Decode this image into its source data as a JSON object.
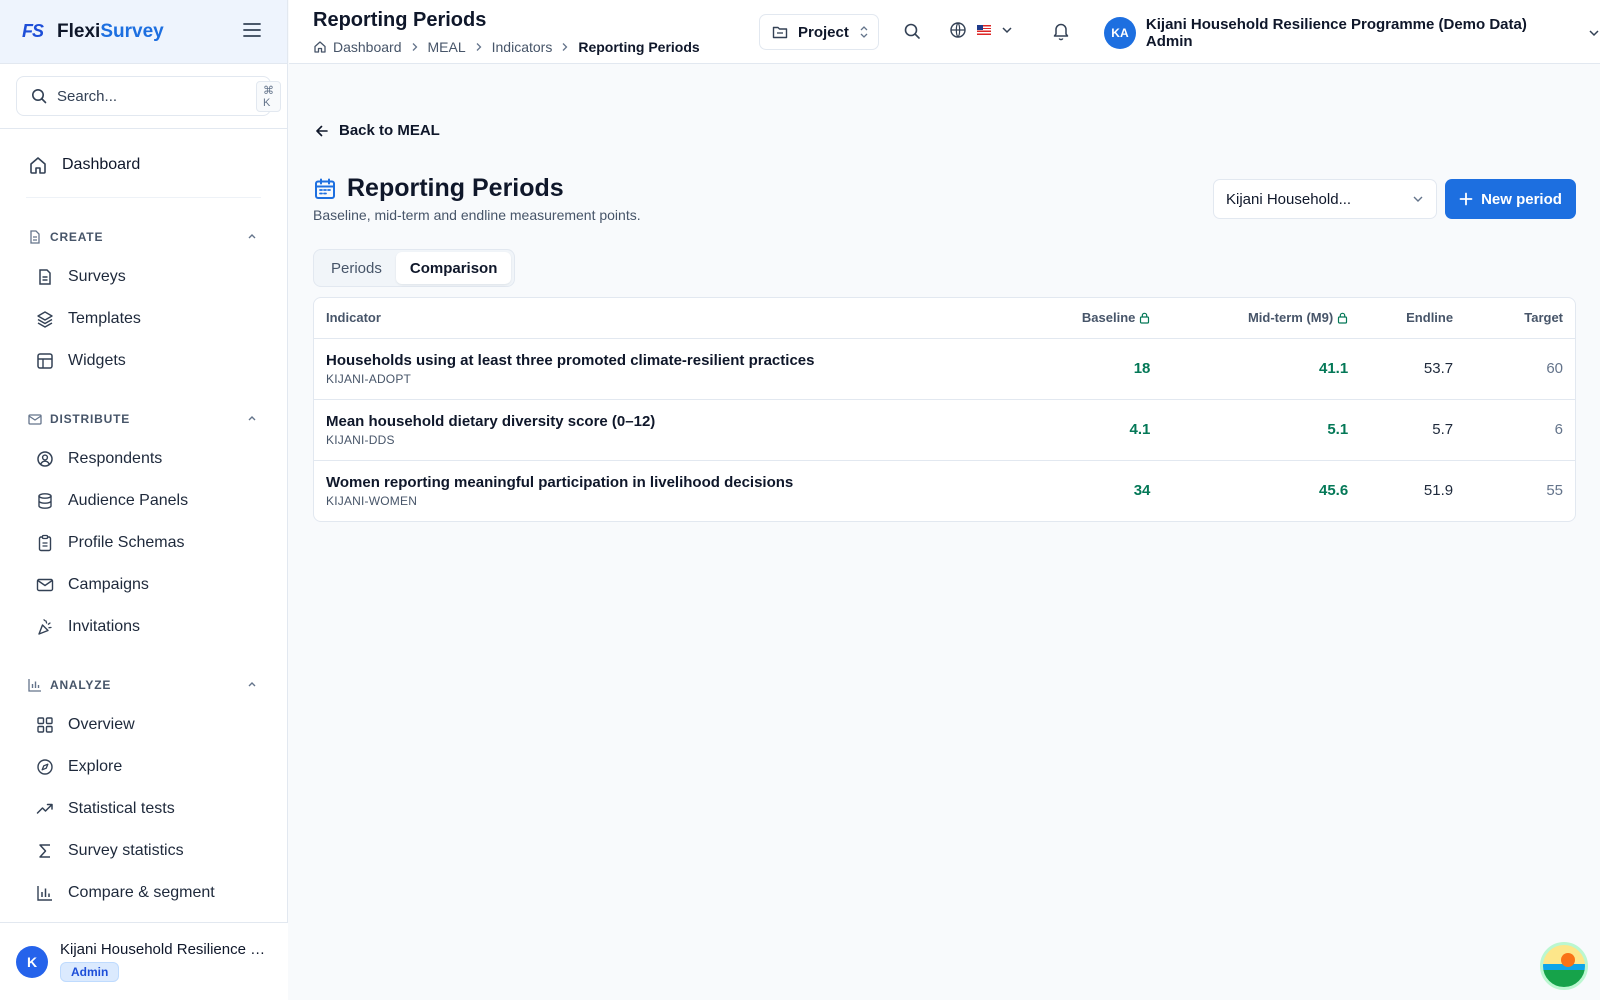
{
  "brand": {
    "logo": "FS",
    "name_main": "Flexi",
    "name_accent": "Survey"
  },
  "search": {
    "placeholder": "Search...",
    "shortcut": "⌘ K"
  },
  "sidebar": {
    "dashboard": "Dashboard",
    "sections": [
      {
        "label": "CREATE",
        "items": [
          "Surveys",
          "Templates",
          "Widgets"
        ]
      },
      {
        "label": "DISTRIBUTE",
        "items": [
          "Respondents",
          "Audience Panels",
          "Profile Schemas",
          "Campaigns",
          "Invitations"
        ]
      },
      {
        "label": "ANALYZE",
        "items": [
          "Overview",
          "Explore",
          "Statistical tests",
          "Survey statistics",
          "Compare & segment"
        ]
      }
    ],
    "footer": {
      "avatar": "K",
      "name": "Kijani Household Resilience Pr...",
      "role": "Admin"
    }
  },
  "topbar": {
    "title": "Reporting Periods",
    "breadcrumbs": [
      "Dashboard",
      "MEAL",
      "Indicators",
      "Reporting Periods"
    ],
    "project_label": "Project",
    "user_initials": "KA",
    "user_name": "Kijani Household Resilience Programme (Demo Data) Admin"
  },
  "page": {
    "back_label": "Back to MEAL",
    "title": "Reporting Periods",
    "subtitle": "Baseline, mid-term and endline measurement points.",
    "program_select": "Kijani Household...",
    "new_button": "New period",
    "tabs": [
      {
        "label": "Periods",
        "active": false
      },
      {
        "label": "Comparison",
        "active": true
      }
    ]
  },
  "table": {
    "headers": {
      "indicator": "Indicator",
      "baseline": "Baseline",
      "midterm": "Mid-term (M9)",
      "endline": "Endline",
      "target": "Target"
    },
    "rows": [
      {
        "name": "Households using at least three promoted climate-resilient practices",
        "code": "KIJANI-ADOPT",
        "baseline": "18",
        "midterm": "41.1",
        "endline": "53.7",
        "target": "60"
      },
      {
        "name": "Mean household dietary diversity score (0–12)",
        "code": "KIJANI-DDS",
        "baseline": "4.1",
        "midterm": "5.1",
        "endline": "5.7",
        "target": "6"
      },
      {
        "name": "Women reporting meaningful participation in livelihood decisions",
        "code": "KIJANI-WOMEN",
        "baseline": "34",
        "midterm": "45.6",
        "endline": "51.9",
        "target": "55"
      }
    ]
  },
  "colors": {
    "accent": "#1d6fe0",
    "locked_value": "#047857",
    "border": "#e2e8f0"
  }
}
